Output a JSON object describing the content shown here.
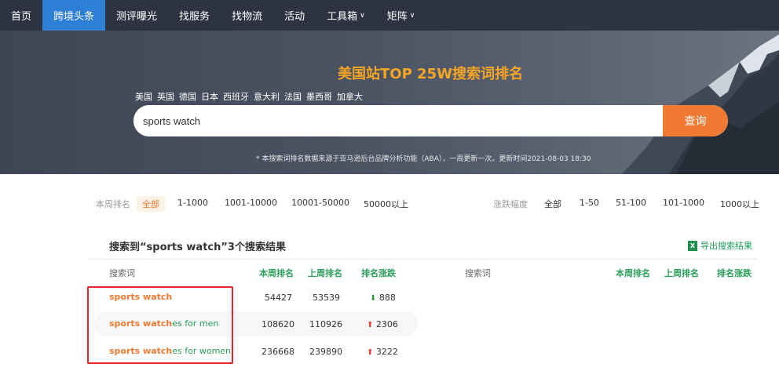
{
  "nav": {
    "items": [
      {
        "label": "首页",
        "active": false
      },
      {
        "label": "跨境头条",
        "active": true
      },
      {
        "label": "测评曝光",
        "active": false
      },
      {
        "label": "找服务",
        "active": false
      },
      {
        "label": "找物流",
        "active": false
      },
      {
        "label": "活动",
        "active": false
      },
      {
        "label": "工具箱",
        "active": false,
        "dropdown": true
      },
      {
        "label": "矩阵",
        "active": false,
        "dropdown": true
      }
    ],
    "caret": "∨"
  },
  "hero": {
    "title": "美国站TOP 25W搜索词排名",
    "sites": [
      "美国",
      "英国",
      "德国",
      "日本",
      "西班牙",
      "意大利",
      "法国",
      "墨西哥",
      "加拿大"
    ],
    "search_value": "sports watch",
    "search_button": "查询",
    "note": "* 本搜索词排名数据来源于亚马逊后台品牌分析功能（ABA），一周更新一次。更新时间2021-08-03 18:30"
  },
  "filters": {
    "rank_label": "本周排名",
    "rank_options": [
      "全部",
      "1-1000",
      "1001-10000",
      "10001-50000",
      "50000以上"
    ],
    "rank_selected": "全部",
    "change_label": "涨跌幅度",
    "change_options": [
      "全部",
      "1-50",
      "51-100",
      "101-1000",
      "1000以上"
    ]
  },
  "results": {
    "title": "搜索到“sports watch”3个搜索结果",
    "export_label": "导出搜索结果",
    "export_icon": "excel-icon",
    "headers": {
      "keyword": "搜索词",
      "this_week": "本周排名",
      "last_week": "上周排名",
      "change": "排名涨跌"
    },
    "rows": [
      {
        "hit": "sports watch",
        "rest": "",
        "this_week": "54427",
        "last_week": "53539",
        "direction": "down",
        "change": "888",
        "arrow": "⬇"
      },
      {
        "hit": "sports watch",
        "rest": "es for men",
        "this_week": "108620",
        "last_week": "110926",
        "direction": "up",
        "change": "2306",
        "arrow": "⬆"
      },
      {
        "hit": "sports watch",
        "rest": "es for women",
        "this_week": "236668",
        "last_week": "239890",
        "direction": "up",
        "change": "3222",
        "arrow": "⬆"
      }
    ]
  },
  "colors": {
    "nav_bg": "#2d3340",
    "nav_active": "#2e7fd6",
    "accent_orange": "#f07a32",
    "title_orange": "#f6a623",
    "green": "#2aa05a",
    "highlight_box": "#e8232a"
  }
}
